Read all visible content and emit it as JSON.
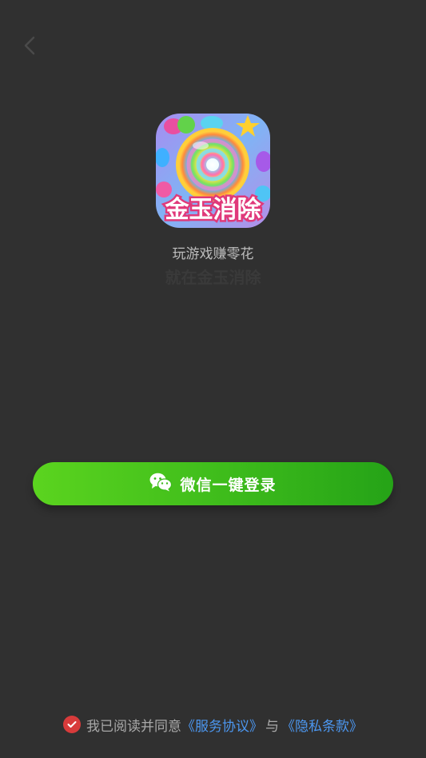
{
  "icons": {
    "back": "chevron-left-icon",
    "wechat": "wechat-icon",
    "checkbox": "checkmark-circle-icon"
  },
  "app": {
    "icon_text": "金玉消除",
    "slogan": "玩游戏赚零花",
    "name": "就在金玉消除"
  },
  "login": {
    "wechat_button_label": "微信一键登录"
  },
  "agreement": {
    "checked": true,
    "prefix": "我已阅读并同意",
    "service_link": "《服务协议》",
    "and": "与",
    "privacy_link": "《隐私条款》"
  },
  "colors": {
    "background": "#303030",
    "button_green_start": "#5bd41f",
    "button_green_end": "#25a317",
    "link_blue": "#4c97f0",
    "checkbox_red": "#d83b3b"
  }
}
